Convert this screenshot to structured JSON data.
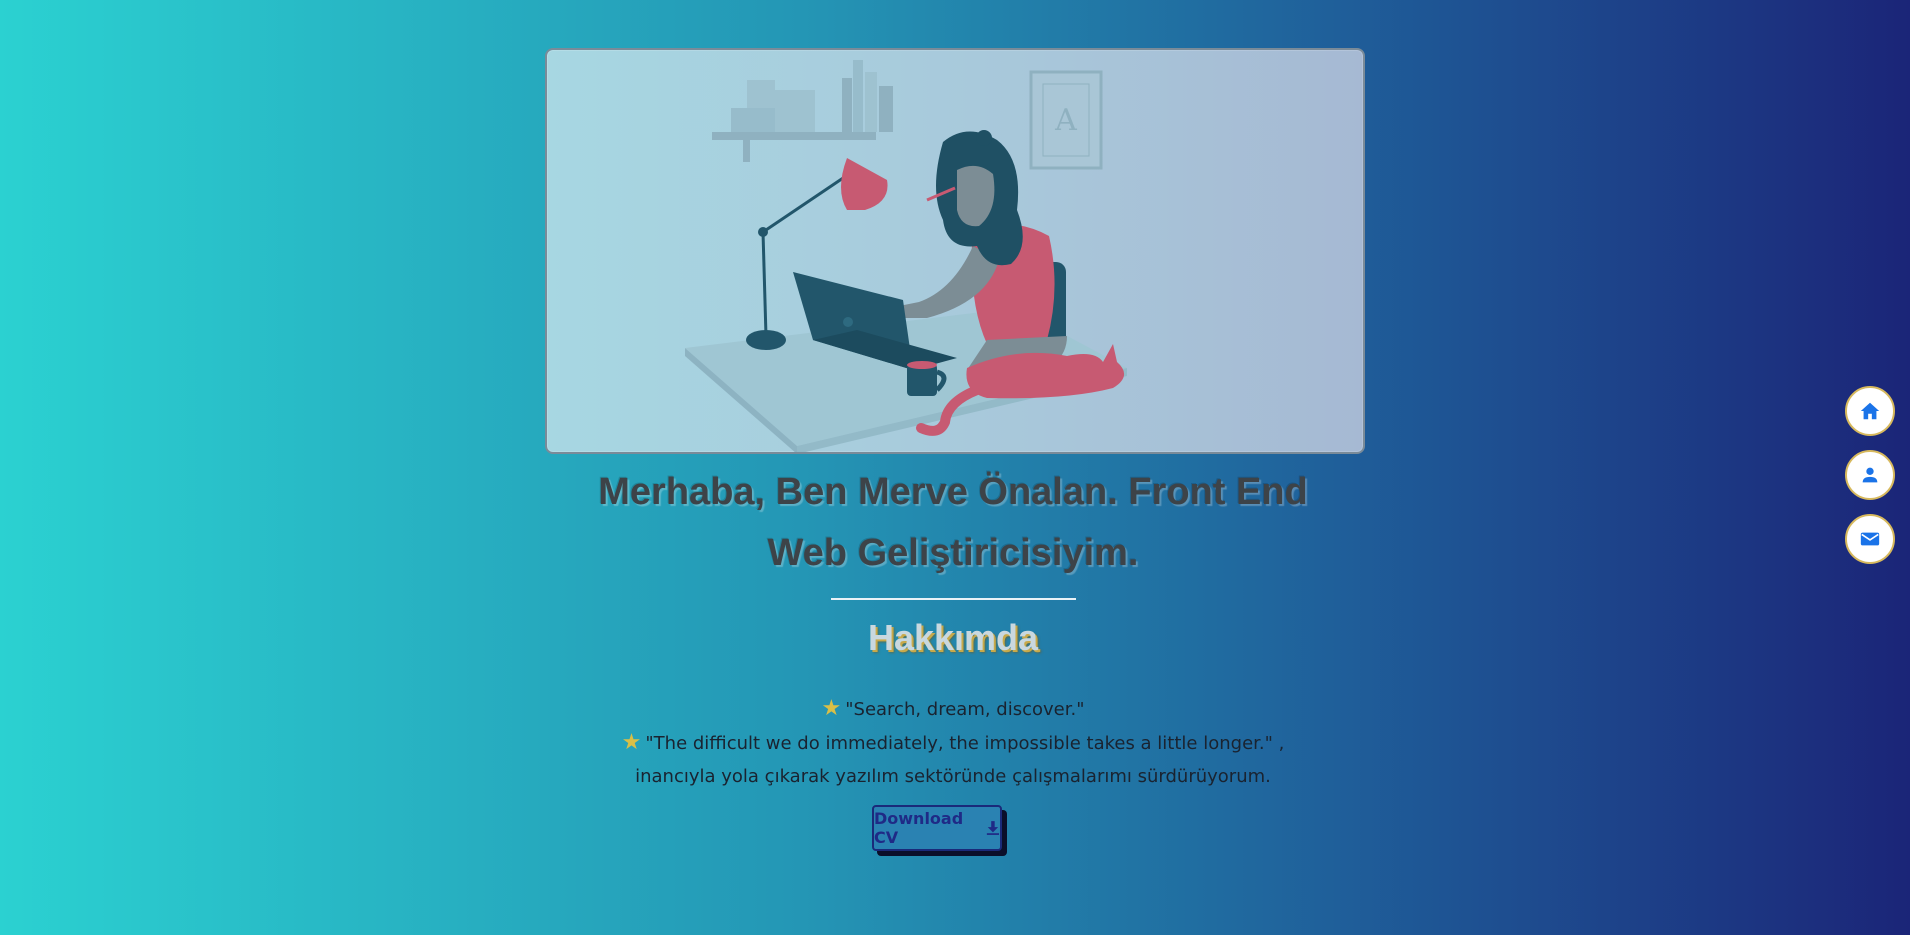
{
  "hero": {
    "illustration": "woman-working-at-laptop-with-cat-illustration",
    "frame_letter": "A"
  },
  "headline": {
    "line1": "Merhaba, Ben Merve Önalan. Front End",
    "line2": "Web Geliştiricisiyim."
  },
  "about": {
    "heading": "Hakkımda",
    "quote1": "\"Search, dream, discover.\"",
    "quote2": "\"The difficult we do immediately, the impossible takes a little longer.\" ,",
    "quote2_cont": "inancıyla yola çıkarak yazılım sektöründe çalışmalarımı sürdürüyorum.",
    "star_icon": "star-icon"
  },
  "cv_button": {
    "label": "Download CV",
    "icon": "download-icon"
  },
  "side_nav": {
    "items": [
      {
        "icon": "home-icon"
      },
      {
        "icon": "person-icon"
      },
      {
        "icon": "mail-icon"
      }
    ]
  },
  "colors": {
    "accent_blue": "#1a73e8",
    "star_gold": "#d9bf47",
    "button_text": "#1f2a86"
  }
}
